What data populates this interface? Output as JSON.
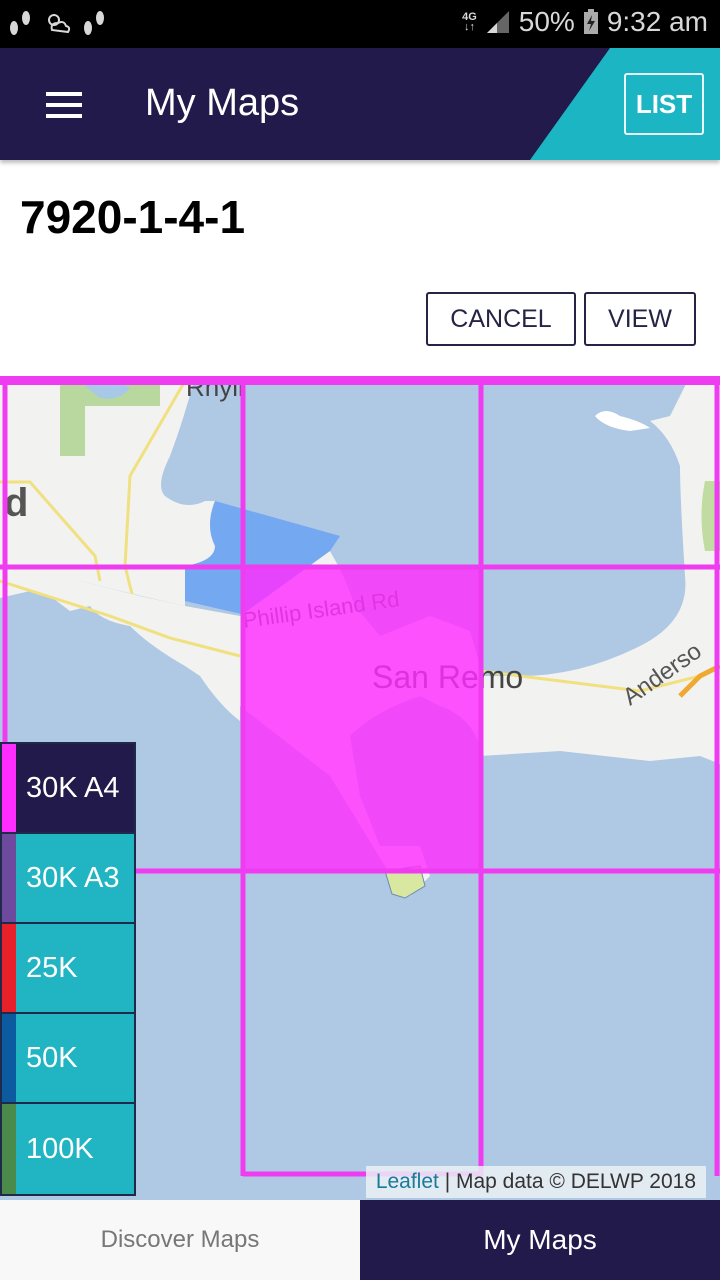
{
  "status_bar": {
    "network": "4G",
    "battery": "50%",
    "time": "9:32 am",
    "icons": [
      "footsteps-icon",
      "weather-icon",
      "footsteps-icon",
      "signal-icon",
      "battery-charging-icon"
    ]
  },
  "header": {
    "title": "My Maps",
    "menu_icon": "hamburger-menu-icon",
    "list_label": "LIST"
  },
  "panel": {
    "map_id": "7920-1-4-1",
    "cancel_label": "CANCEL",
    "view_label": "VIEW"
  },
  "map": {
    "labels": {
      "place_top": "Rhyll",
      "place_left": "d",
      "road": "Phillip Island Rd",
      "town": "San Remo",
      "road_right": "Anderso"
    },
    "grid_color": "#f03cf0",
    "selected_tile_color": "#ff2dff",
    "attribution": {
      "link": "Leaflet",
      "separator": " | ",
      "text": "Map data © DELWP 2018"
    }
  },
  "legend": {
    "items": [
      {
        "label": "30K A4",
        "color": "#ff2dff",
        "active": true
      },
      {
        "label": "30K A3",
        "color": "#6e4a9e",
        "active": false
      },
      {
        "label": "25K",
        "color": "#e8202a",
        "active": false
      },
      {
        "label": "50K",
        "color": "#0c5aa0",
        "active": false
      },
      {
        "label": "100K",
        "color": "#4a8a4a",
        "active": false
      }
    ]
  },
  "bottom_nav": {
    "tabs": [
      {
        "label": "Discover Maps",
        "active": false
      },
      {
        "label": "My Maps",
        "active": true
      }
    ]
  }
}
